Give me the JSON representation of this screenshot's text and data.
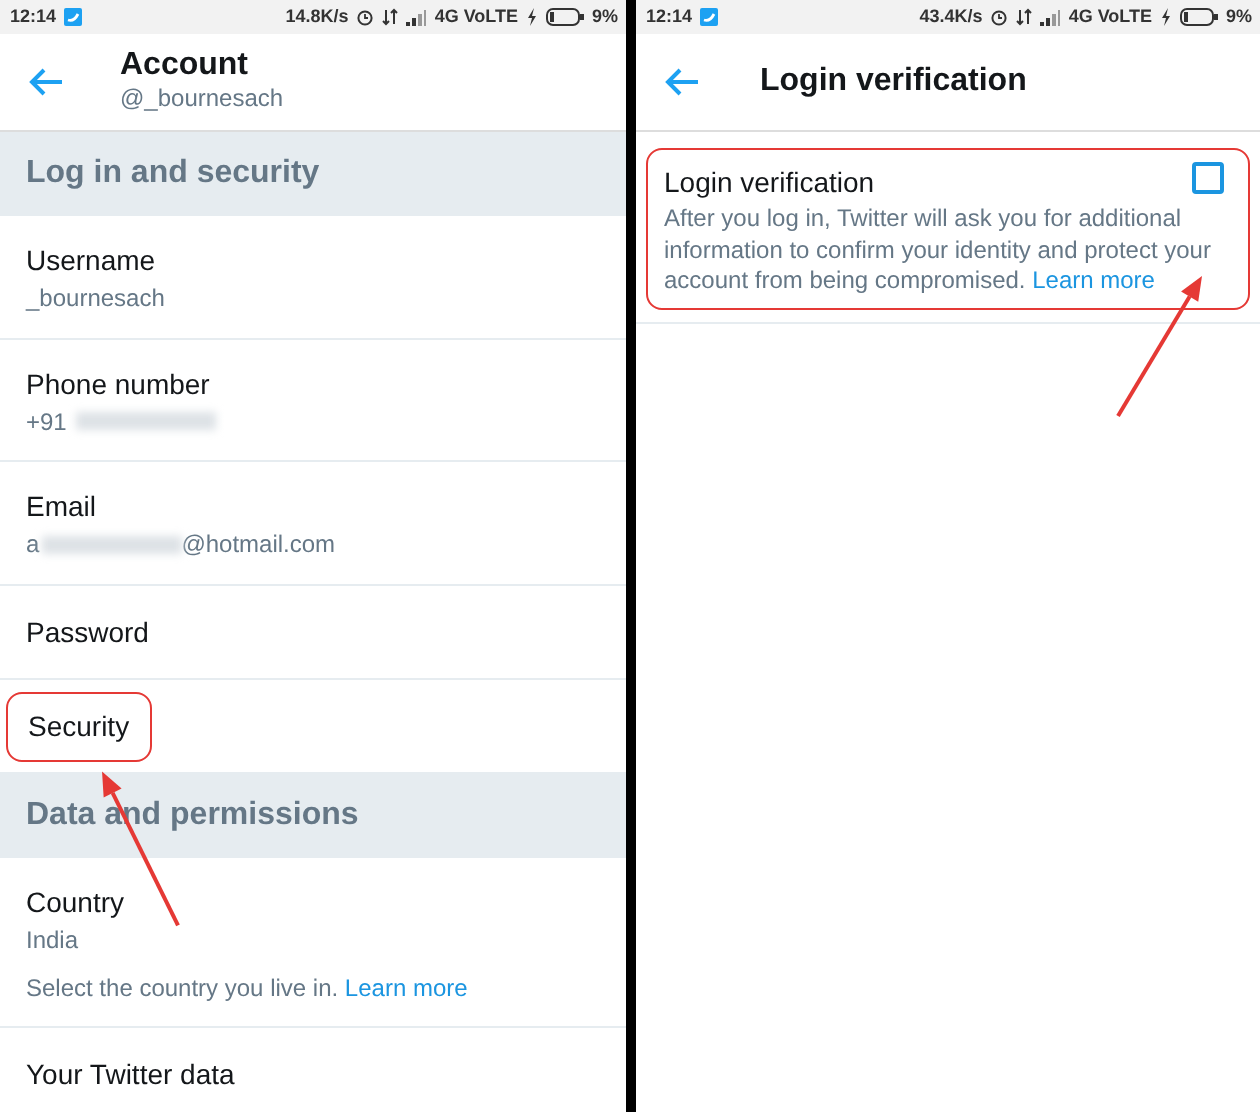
{
  "screens": [
    {
      "status_bar": {
        "time": "12:14",
        "speed": "14.8K/s",
        "network": "4G VoLTE",
        "battery": "9%"
      },
      "header": {
        "title": "Account",
        "subtitle": "@_bournesach"
      },
      "sections": [
        {
          "title": "Log in and security",
          "rows": [
            {
              "label": "Username",
              "value": "_bournesach",
              "highlighted": false
            },
            {
              "label": "Phone number",
              "value": "+91",
              "redacted": true,
              "highlighted": false
            },
            {
              "label": "Email",
              "value": "a",
              "redacted": true,
              "value_end": "@hotmail.com",
              "highlighted": false
            },
            {
              "label": "Password",
              "highlighted": false
            },
            {
              "label": "Security",
              "highlighted": true
            }
          ]
        },
        {
          "title": "Data and permissions",
          "rows": [
            {
              "label": "Country",
              "value": "India",
              "helper": "Select the country you live in.",
              "link": "Learn more",
              "highlighted": false
            },
            {
              "label": "Your Twitter data",
              "highlighted": false
            }
          ]
        }
      ]
    },
    {
      "status_bar": {
        "time": "12:14",
        "speed": "43.4K/s",
        "network": "4G VoLTE",
        "battery": "9%"
      },
      "header": {
        "title": "Login verification"
      },
      "settings": [
        {
          "title": "Login verification",
          "description": "After you log in, Twitter will ask you for additional information to confirm your identity and protect your account from being compromised.",
          "link": "Learn more",
          "checked": false,
          "highlighted": true
        }
      ]
    }
  ]
}
